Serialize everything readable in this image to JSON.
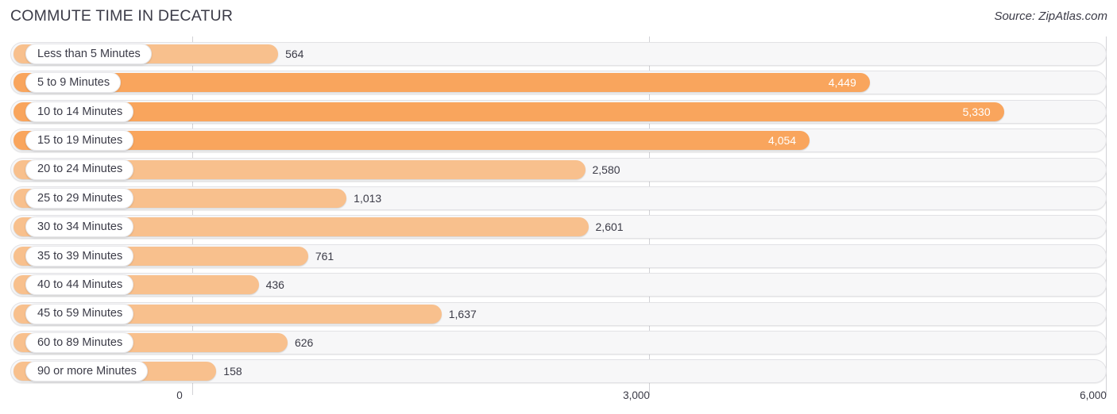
{
  "header": {
    "title": "COMMUTE TIME IN DECATUR",
    "source": "Source: ZipAtlas.com"
  },
  "colors": {
    "bar_strong": "#f9a55d",
    "bar_soft": "#f8c08d",
    "track": "#f7f7f8",
    "text": "#3b3b47",
    "gridline": "#d2d2d6"
  },
  "chart_data": {
    "type": "bar",
    "orientation": "horizontal",
    "title": "COMMUTE TIME IN DECATUR",
    "xlabel": "",
    "ylabel": "",
    "xlim": [
      0,
      6000
    ],
    "grid": true,
    "legend": false,
    "xticks": [
      "0",
      "3,000",
      "6,000"
    ],
    "xtick_values": [
      0,
      3000,
      6000
    ],
    "categories": [
      "Less than 5 Minutes",
      "5 to 9 Minutes",
      "10 to 14 Minutes",
      "15 to 19 Minutes",
      "20 to 24 Minutes",
      "25 to 29 Minutes",
      "30 to 34 Minutes",
      "35 to 39 Minutes",
      "40 to 44 Minutes",
      "45 to 59 Minutes",
      "60 to 89 Minutes",
      "90 or more Minutes"
    ],
    "values": [
      564,
      4449,
      5330,
      4054,
      2580,
      1013,
      2601,
      761,
      436,
      1637,
      626,
      158
    ],
    "value_labels": [
      "564",
      "4,449",
      "5,330",
      "4,054",
      "2,580",
      "1,013",
      "2,601",
      "761",
      "436",
      "1,637",
      "626",
      "158"
    ]
  },
  "rows": [
    {
      "label": "Less than 5 Minutes",
      "value": 564,
      "text": "564",
      "inside": false,
      "tone": "soft"
    },
    {
      "label": "5 to 9 Minutes",
      "value": 4449,
      "text": "4,449",
      "inside": true,
      "tone": "strong"
    },
    {
      "label": "10 to 14 Minutes",
      "value": 5330,
      "text": "5,330",
      "inside": true,
      "tone": "strong"
    },
    {
      "label": "15 to 19 Minutes",
      "value": 4054,
      "text": "4,054",
      "inside": true,
      "tone": "strong"
    },
    {
      "label": "20 to 24 Minutes",
      "value": 2580,
      "text": "2,580",
      "inside": false,
      "tone": "soft"
    },
    {
      "label": "25 to 29 Minutes",
      "value": 1013,
      "text": "1,013",
      "inside": false,
      "tone": "soft"
    },
    {
      "label": "30 to 34 Minutes",
      "value": 2601,
      "text": "2,601",
      "inside": false,
      "tone": "soft"
    },
    {
      "label": "35 to 39 Minutes",
      "value": 761,
      "text": "761",
      "inside": false,
      "tone": "soft"
    },
    {
      "label": "40 to 44 Minutes",
      "value": 436,
      "text": "436",
      "inside": false,
      "tone": "soft"
    },
    {
      "label": "45 to 59 Minutes",
      "value": 1637,
      "text": "1,637",
      "inside": false,
      "tone": "soft"
    },
    {
      "label": "60 to 89 Minutes",
      "value": 626,
      "text": "626",
      "inside": false,
      "tone": "soft"
    },
    {
      "label": "90 or more Minutes",
      "value": 158,
      "text": "158",
      "inside": false,
      "tone": "soft"
    }
  ]
}
